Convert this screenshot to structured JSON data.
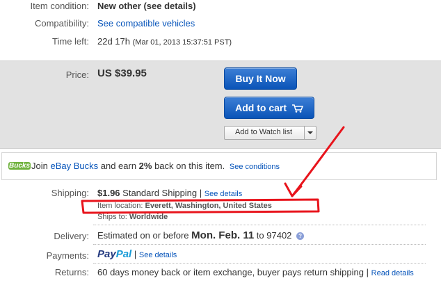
{
  "item": {
    "condition_label": "Item condition:",
    "condition_value": "New other (see details)",
    "compat_label": "Compatibility:",
    "compat_link": "See compatible vehicles",
    "time_label": "Time left:",
    "time_value": "22d 17h",
    "time_detail": "(Mar 01, 2013  15:37:51 PST)"
  },
  "price": {
    "label": "Price:",
    "value": "US $39.95",
    "buy_now": "Buy It Now",
    "add_to_cart": "Add to cart",
    "watch": "Add to Watch list"
  },
  "bucks": {
    "logo": "Bucks",
    "join": "Join ",
    "brand": "eBay Bucks",
    "mid": " and earn ",
    "percent": "2%",
    "tail": " back on this item.",
    "link": "See conditions"
  },
  "shipping": {
    "label": "Shipping:",
    "cost": "$1.96",
    "method": "Standard Shipping",
    "sep": "|",
    "link": "See details",
    "location_label": "Item location:",
    "location_value": "Everett, Washington, United States",
    "ships_label": "Ships to:",
    "ships_value": "Worldwide"
  },
  "delivery": {
    "label": "Delivery:",
    "text": "Estimated on or before",
    "date": "Mon. Feb. 11",
    "to": "to 97402"
  },
  "payments": {
    "label": "Payments:",
    "paypal_a": "Pay",
    "paypal_b": "Pal",
    "sep": "|",
    "link": "See details"
  },
  "returns": {
    "label": "Returns:",
    "text": "60 days money back or item exchange, buyer pays return shipping",
    "sep": "|",
    "link": "Read details"
  },
  "colors": {
    "annotation": "#e8141c",
    "button": "#0a54b8",
    "link": "#0654ba"
  }
}
